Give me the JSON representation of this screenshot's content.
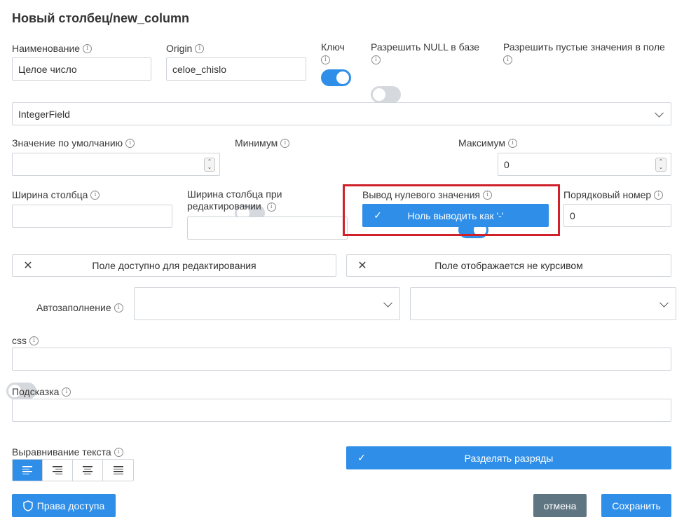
{
  "title": "Новый столбец/new_column",
  "info_symbol": "i",
  "fields": {
    "name": {
      "label": "Наименование",
      "value": "Целое число"
    },
    "origin": {
      "label": "Origin",
      "value": "celoe_chislo"
    },
    "key": {
      "label": "Ключ",
      "on": true
    },
    "allow_null": {
      "label": "Разрешить NULL в базе",
      "on": false
    },
    "allow_empty": {
      "label": "Разрешить пустые значения в поле",
      "on": false
    },
    "field_type": {
      "value": "IntegerField"
    },
    "default_value": {
      "label": "Значение по умолчанию",
      "value": ""
    },
    "minimum": {
      "label": "Минимум",
      "on": false
    },
    "maximum": {
      "label": "Максимум",
      "on": true,
      "value": "0"
    },
    "column_width": {
      "label": "Ширина столбца",
      "value": ""
    },
    "edit_column_width": {
      "label": "Ширина столбца при редактировании",
      "value": ""
    },
    "zero_output": {
      "label": "Вывод нулевого значения",
      "button": "Ноль выводить как '-'"
    },
    "order_number": {
      "label": "Порядковый номер",
      "value": "0"
    },
    "editable_button": "Поле доступно для редактирования",
    "italic_button": "Поле отображается не курсивом",
    "autofill": {
      "label": "Автозаполнение",
      "on": false
    },
    "css": {
      "label": "css",
      "value": ""
    },
    "hint": {
      "label": "Подсказка",
      "value": ""
    },
    "text_align": {
      "label": "Выравнивание текста",
      "options": [
        "left",
        "right",
        "center",
        "justify"
      ],
      "selected": "left"
    },
    "separate_digits": "Разделять разряды"
  },
  "footer": {
    "access_rights": "Права доступа",
    "cancel": "отмена",
    "save": "Сохранить"
  },
  "colors": {
    "accent": "#2e8ee8",
    "highlight_border": "#d0202a",
    "cancel_bg": "#5f7582"
  },
  "icons": {
    "spinner_up": "⌃",
    "spinner_down": "⌄",
    "close": "✕",
    "check": "✓"
  }
}
